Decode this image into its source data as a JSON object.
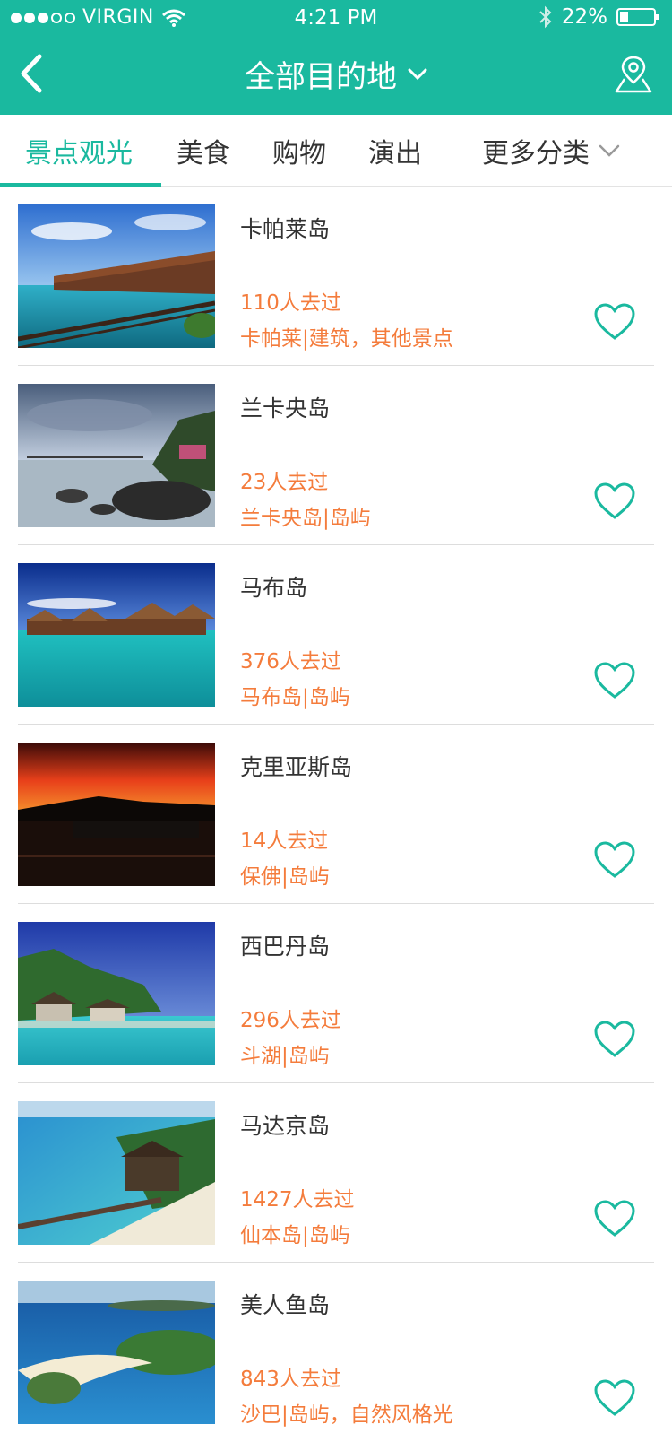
{
  "status_bar": {
    "carrier": "VIRGIN",
    "time": "4:21 PM",
    "battery": "22%"
  },
  "nav": {
    "title": "全部目的地"
  },
  "tabs": [
    {
      "label": "景点观光",
      "active": true
    },
    {
      "label": "美食"
    },
    {
      "label": "购物"
    },
    {
      "label": "演出"
    },
    {
      "label": "更多分类"
    }
  ],
  "items": [
    {
      "name": "卡帕莱岛",
      "visits": "110人去过",
      "tags": "卡帕莱|建筑，其他景点"
    },
    {
      "name": "兰卡央岛",
      "visits": "23人去过",
      "tags": "兰卡央岛|岛屿"
    },
    {
      "name": "马布岛",
      "visits": "376人去过",
      "tags": "马布岛|岛屿"
    },
    {
      "name": "克里亚斯岛",
      "visits": "14人去过",
      "tags": "保佛|岛屿"
    },
    {
      "name": "西巴丹岛",
      "visits": "296人去过",
      "tags": "斗湖|岛屿"
    },
    {
      "name": "马达京岛",
      "visits": "1427人去过",
      "tags": "仙本岛|岛屿"
    },
    {
      "name": "美人鱼岛",
      "visits": "843人去过",
      "tags": "沙巴|岛屿，自然风格光"
    }
  ],
  "colors": {
    "accent": "#1ab99f",
    "orange_text": "#f47c3c"
  }
}
